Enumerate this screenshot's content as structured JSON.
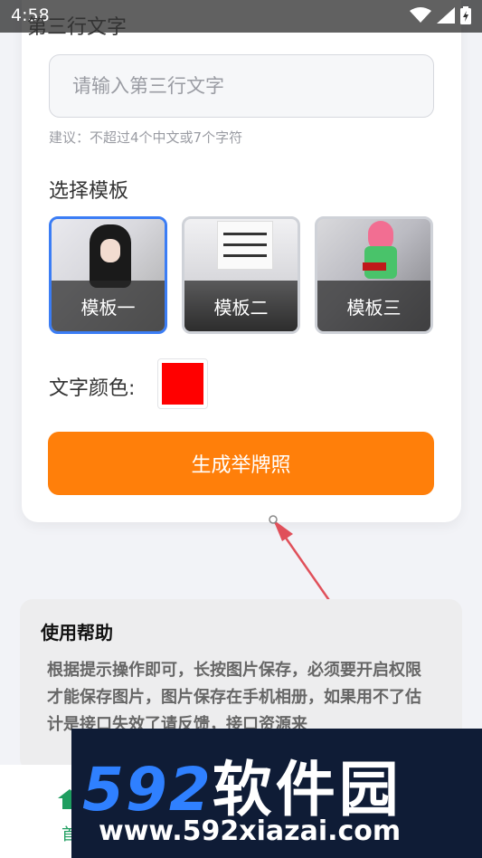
{
  "status_bar": {
    "time": "4:58"
  },
  "form": {
    "line3_label": "第三行文字",
    "line3_placeholder": "请输入第三行文字",
    "line3_hint": "建议：不超过4个中文或7个字符",
    "template_label": "选择模板",
    "templates": [
      {
        "caption": "模板一",
        "selected": true
      },
      {
        "caption": "模板二",
        "selected": false
      },
      {
        "caption": "模板三",
        "selected": false
      }
    ],
    "color_label": "文字颜色:",
    "text_color": "#ff0000",
    "generate_button": "生成举牌照"
  },
  "help": {
    "title": "使用帮助",
    "text": "根据提示操作即可，长按图片保存，必须要开启权限才能保存图片，图片保存在手机相册，如果用不了估计是接口失效了请反馈，接口资源来"
  },
  "bottom_nav": {
    "home_label": "首"
  },
  "watermark": {
    "logo_num": "592",
    "logo_cn": "软件园",
    "url": "www.592xiazai.com"
  },
  "colors": {
    "accent": "#ff7f0a",
    "selected_border": "#3b7df5",
    "arrow": "#e0505a",
    "nav_active": "#1f9e60"
  }
}
